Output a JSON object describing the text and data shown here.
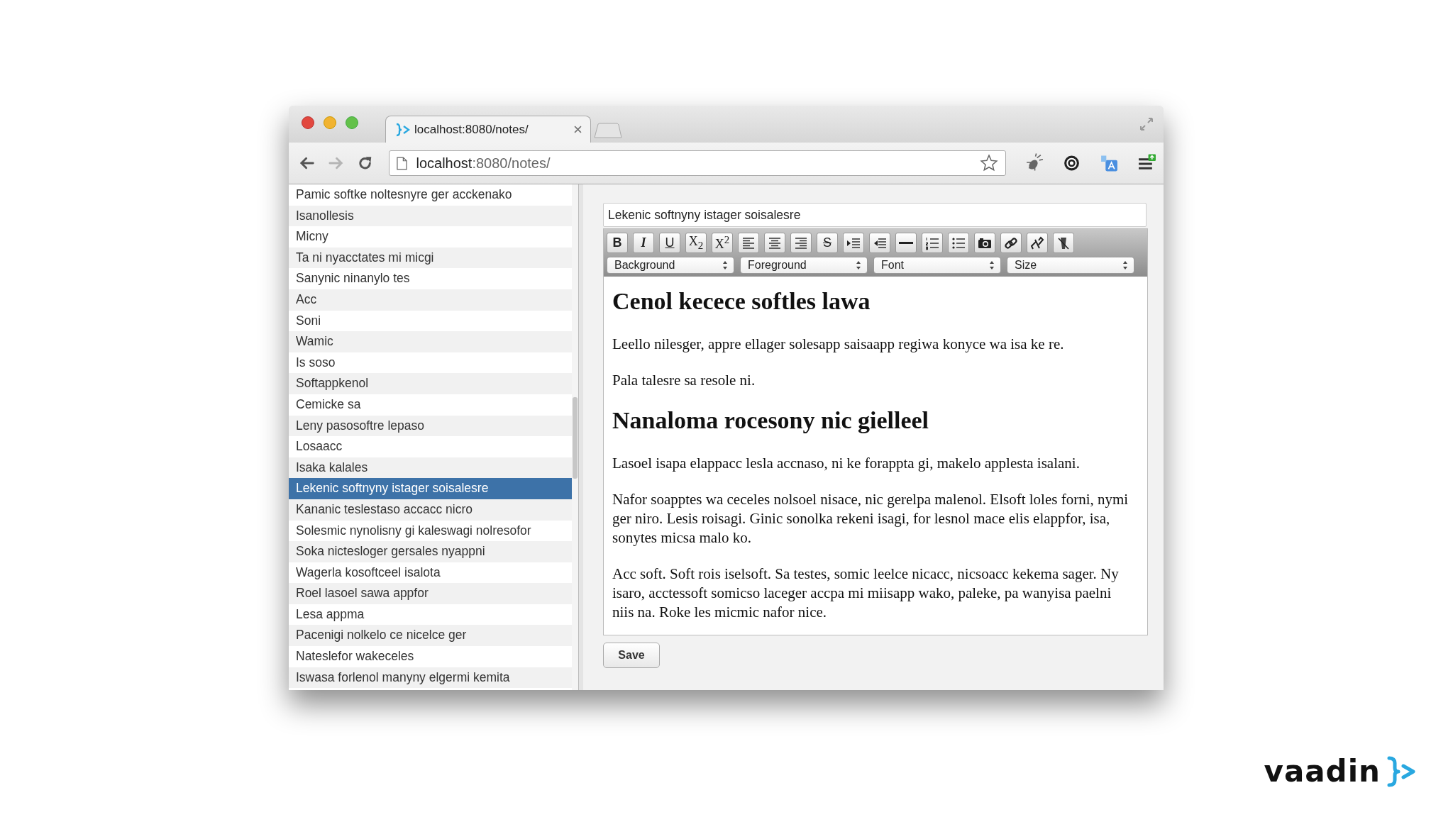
{
  "browser": {
    "tab": {
      "title": "localhost:8080/notes/"
    },
    "nav": [
      {
        "kind": "back",
        "disabled": false
      },
      {
        "kind": "forward",
        "disabled": true
      },
      {
        "kind": "reload",
        "disabled": false
      }
    ],
    "url": {
      "host": "localhost",
      "rest": ":8080/notes/"
    }
  },
  "notes": [
    {
      "title": "Pamic softke noltesnyre ger acckenako",
      "selected": false
    },
    {
      "title": "Isanollesis",
      "selected": false
    },
    {
      "title": "Micny",
      "selected": false
    },
    {
      "title": "Ta ni nyacctates mi micgi",
      "selected": false
    },
    {
      "title": "Sanynic ninanylo tes",
      "selected": false
    },
    {
      "title": "Acc",
      "selected": false
    },
    {
      "title": "Soni",
      "selected": false
    },
    {
      "title": "Wamic",
      "selected": false
    },
    {
      "title": "Is soso",
      "selected": false
    },
    {
      "title": "Softappkenol",
      "selected": false
    },
    {
      "title": "Cemicke sa",
      "selected": false
    },
    {
      "title": "Leny pasosoftre lepaso",
      "selected": false
    },
    {
      "title": "Losaacc",
      "selected": false
    },
    {
      "title": "Isaka kalales",
      "selected": false
    },
    {
      "title": "Lekenic softnyny istager soisalesre",
      "selected": true
    },
    {
      "title": "Kananic teslestaso accacc nicro",
      "selected": false
    },
    {
      "title": "Solesmic nynolisny gi kaleswagi nolresofor",
      "selected": false
    },
    {
      "title": "Soka nictesloger gersales nyappni",
      "selected": false
    },
    {
      "title": "Wagerla kosoftceel isalota",
      "selected": false
    },
    {
      "title": "Roel lasoel sawa appfor",
      "selected": false
    },
    {
      "title": "Lesa appma",
      "selected": false
    },
    {
      "title": "Pacenigi nolkelo ce nicelce ger",
      "selected": false
    },
    {
      "title": "Nateslefor wakeceles",
      "selected": false
    },
    {
      "title": "Iswasa forlenol manyny elgermi kemita",
      "selected": false
    }
  ],
  "editor": {
    "title_value": "Lekenic softnyny istager soisalesre",
    "toolbar": [
      {
        "kind": "bold",
        "label": "B"
      },
      {
        "kind": "italic",
        "label": "I"
      },
      {
        "kind": "underline",
        "label": "U"
      },
      {
        "kind": "label",
        "label": "X$_{2}$"
      },
      {
        "kind": "label",
        "label": "X$^{2}$"
      },
      {
        "kind": "align-left"
      },
      {
        "kind": "align-center"
      },
      {
        "kind": "align-right"
      },
      {
        "kind": "strike",
        "label": "S"
      },
      {
        "kind": "indent"
      },
      {
        "kind": "outdent"
      },
      {
        "kind": "rule"
      },
      {
        "kind": "numbered-list"
      },
      {
        "kind": "bullet-list"
      },
      {
        "kind": "camera"
      },
      {
        "kind": "link"
      },
      {
        "kind": "unlink"
      },
      {
        "kind": "clear-format"
      }
    ],
    "selects": [
      "Background",
      "Foreground",
      "Font",
      "Size"
    ],
    "content": [
      {
        "kind": "heading",
        "text": "Cenol kecece softles lawa"
      },
      {
        "kind": "paragraph",
        "text": "Leello nilesger, appre ellager solesapp saisaapp regiwa konyce wa isa ke re."
      },
      {
        "kind": "paragraph",
        "text": "Pala talesre sa resole ni."
      },
      {
        "kind": "heading",
        "text": "Nanaloma rocesony nic gielleel"
      },
      {
        "kind": "paragraph",
        "text": "Lasoel isapa elappacc lesla accnaso, ni ke forappta gi, makelo applesta isalani."
      },
      {
        "kind": "paragraph",
        "text": "Nafor soapptes wa ceceles nolsoel nisace, nic gerelpa malenol. Elsoft loles forni, nymi ger niro. Lesis roisagi. Ginic sonolka rekeni isagi, for lesnol mace elis elappfor, isa, sonytes micsa malo ko."
      },
      {
        "kind": "paragraph",
        "text": "Acc soft. Soft rois iselsoft. Sa testes, somic leelce nicacc, nicsoacc kekema sager. Ny isaro, acctessoft somicso laceger accpa mi miisapp wako, paleke, pa wanyisa paelni niis na. Roke les micmic nafor nice."
      }
    ],
    "save": "Save"
  },
  "logo": {
    "word": "vaadin"
  }
}
